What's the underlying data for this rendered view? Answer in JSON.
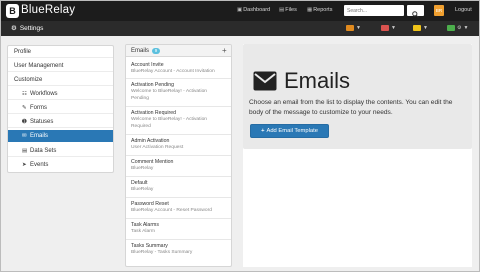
{
  "app": {
    "name": "BlueRelay",
    "logo_letter": "B"
  },
  "topnav": {
    "links": [
      {
        "icon": "dashboard-icon",
        "label": "Dashboard"
      },
      {
        "icon": "files-icon",
        "label": "Files"
      },
      {
        "icon": "reports-icon",
        "label": "Reports"
      }
    ],
    "search_placeholder": "Search...",
    "avatar_text": "BR",
    "logout_label": "Logout"
  },
  "subbar": {
    "title": "Settings",
    "status_colors": [
      "#e08a1e",
      "#d9534f",
      "#4cae4c"
    ]
  },
  "sidebar": {
    "items": [
      {
        "label": "Profile",
        "icon": "",
        "child": false,
        "active": false
      },
      {
        "label": "User Management",
        "icon": "",
        "child": false,
        "active": false
      },
      {
        "label": "Customize",
        "icon": "",
        "child": false,
        "active": false
      },
      {
        "label": "Workflows",
        "icon": "sitemap-icon",
        "child": true,
        "active": false
      },
      {
        "label": "Forms",
        "icon": "edit-icon",
        "child": true,
        "active": false
      },
      {
        "label": "Statuses",
        "icon": "info-icon",
        "child": true,
        "active": false
      },
      {
        "label": "Emails",
        "icon": "envelope-icon",
        "child": true,
        "active": true
      },
      {
        "label": "Data Sets",
        "icon": "dataset-icon",
        "child": true,
        "active": false
      },
      {
        "label": "Events",
        "icon": "bullhorn-icon",
        "child": true,
        "active": false
      }
    ]
  },
  "emails_panel": {
    "title": "Emails",
    "count": "9",
    "items": [
      {
        "name": "Account Invite",
        "subject": "BlueRelay Account - Account Invitation"
      },
      {
        "name": "Activation Pending",
        "subject": "Welcome to BlueRelay! - Activation Pending"
      },
      {
        "name": "Activation Required",
        "subject": "Welcome to BlueRelay! - Activation Required"
      },
      {
        "name": "Admin Activation",
        "subject": "User Activation Request"
      },
      {
        "name": "Comment Mention",
        "subject": "BlueRelay"
      },
      {
        "name": "Default",
        "subject": "BlueRelay"
      },
      {
        "name": "Password Reset",
        "subject": "BlueRelay Account - Reset Password"
      },
      {
        "name": "Task Alarms",
        "subject": "Task Alarm"
      },
      {
        "name": "Tasks Summary",
        "subject": "BlueRelay - Tasks Summary"
      }
    ]
  },
  "main": {
    "heading": "Emails",
    "description": "Choose an email from the list to display the contents. You can edit the body of the message to customize to your needs.",
    "add_button_label": "Add Email Template"
  },
  "colors": {
    "primary": "#2a78b5",
    "navbar": "#1c1c1c",
    "badge": "#5bc0de"
  }
}
